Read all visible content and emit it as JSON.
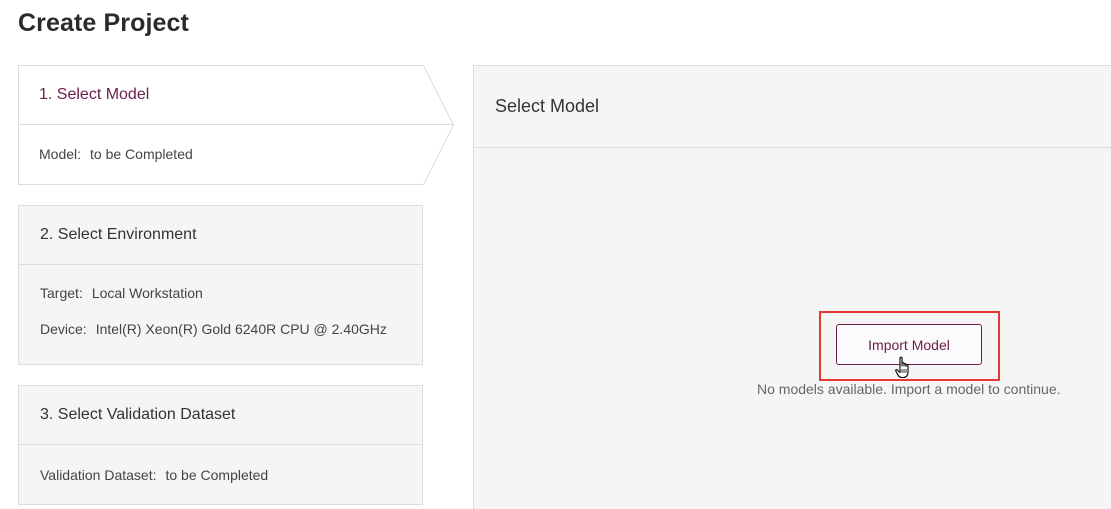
{
  "page": {
    "title": "Create Project"
  },
  "steps": [
    {
      "title": "1. Select Model",
      "fields": [
        {
          "key": "Model:",
          "value": "to be Completed"
        }
      ]
    },
    {
      "title": "2. Select Environment",
      "fields": [
        {
          "key": "Target:",
          "value": "Local Workstation"
        },
        {
          "key": "Device:",
          "value": "Intel(R) Xeon(R) Gold 6240R CPU @ 2.40GHz"
        }
      ]
    },
    {
      "title": "3. Select Validation Dataset",
      "fields": [
        {
          "key": "Validation Dataset:",
          "value": "to be Completed"
        }
      ]
    }
  ],
  "panel": {
    "title": "Select Model",
    "import_button": "Import Model",
    "empty_message": "No models available. Import a model to continue."
  },
  "colors": {
    "accent": "#6b1d4b",
    "highlight": "#e53935",
    "panel_bg": "#f5f5f5",
    "border": "#dcdcdc"
  },
  "icons": {
    "cursor": "hand-pointer-icon"
  }
}
